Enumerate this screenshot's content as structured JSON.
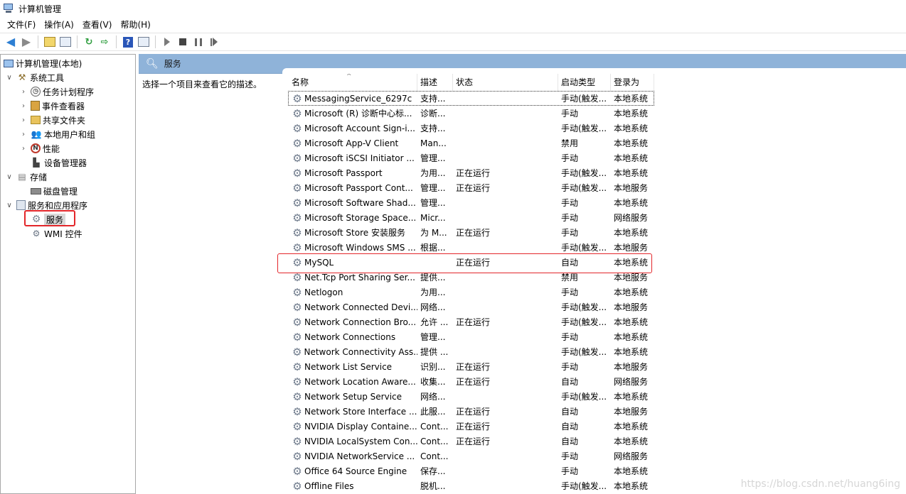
{
  "window": {
    "title": "计算机管理"
  },
  "menu": [
    "文件(F)",
    "操作(A)",
    "查看(V)",
    "帮助(H)"
  ],
  "tree": {
    "root": "计算机管理(本地)",
    "system_tools": "系统工具",
    "task_scheduler": "任务计划程序",
    "event_viewer": "事件查看器",
    "shared_folders": "共享文件夹",
    "local_users": "本地用户和组",
    "performance": "性能",
    "device_manager": "设备管理器",
    "storage": "存储",
    "disk_management": "磁盘管理",
    "services_apps": "服务和应用程序",
    "services": "服务",
    "wmi": "WMI 控件"
  },
  "panel": {
    "title": "服务",
    "description_hint": "选择一个项目来查看它的描述。"
  },
  "columns": {
    "name": "名称",
    "desc": "描述",
    "status": "状态",
    "startup": "启动类型",
    "logon": "登录为"
  },
  "services": [
    {
      "name": "MessagingService_6297c",
      "desc": "支持...",
      "status": "",
      "startup": "手动(触发...",
      "logon": "本地系统"
    },
    {
      "name": "Microsoft (R) 诊断中心标...",
      "desc": "诊断...",
      "status": "",
      "startup": "手动",
      "logon": "本地系统"
    },
    {
      "name": "Microsoft Account Sign-i...",
      "desc": "支持...",
      "status": "",
      "startup": "手动(触发...",
      "logon": "本地系统"
    },
    {
      "name": "Microsoft App-V Client",
      "desc": "Man...",
      "status": "",
      "startup": "禁用",
      "logon": "本地系统"
    },
    {
      "name": "Microsoft iSCSI Initiator ...",
      "desc": "管理...",
      "status": "",
      "startup": "手动",
      "logon": "本地系统"
    },
    {
      "name": "Microsoft Passport",
      "desc": "为用...",
      "status": "正在运行",
      "startup": "手动(触发...",
      "logon": "本地系统"
    },
    {
      "name": "Microsoft Passport Cont...",
      "desc": "管理...",
      "status": "正在运行",
      "startup": "手动(触发...",
      "logon": "本地服务"
    },
    {
      "name": "Microsoft Software Shad...",
      "desc": "管理...",
      "status": "",
      "startup": "手动",
      "logon": "本地系统"
    },
    {
      "name": "Microsoft Storage Space...",
      "desc": "Micr...",
      "status": "",
      "startup": "手动",
      "logon": "网络服务"
    },
    {
      "name": "Microsoft Store 安装服务",
      "desc": "为 M...",
      "status": "正在运行",
      "startup": "手动",
      "logon": "本地系统"
    },
    {
      "name": "Microsoft Windows SMS ...",
      "desc": "根据...",
      "status": "",
      "startup": "手动(触发...",
      "logon": "本地服务"
    },
    {
      "name": "MySQL",
      "desc": "",
      "status": "正在运行",
      "startup": "自动",
      "logon": "本地系统"
    },
    {
      "name": "Net.Tcp Port Sharing Ser...",
      "desc": "提供...",
      "status": "",
      "startup": "禁用",
      "logon": "本地服务"
    },
    {
      "name": "Netlogon",
      "desc": "为用...",
      "status": "",
      "startup": "手动",
      "logon": "本地系统"
    },
    {
      "name": "Network Connected Devi...",
      "desc": "网络...",
      "status": "",
      "startup": "手动(触发...",
      "logon": "本地服务"
    },
    {
      "name": "Network Connection Bro...",
      "desc": "允许 ...",
      "status": "正在运行",
      "startup": "手动(触发...",
      "logon": "本地系统"
    },
    {
      "name": "Network Connections",
      "desc": "管理...",
      "status": "",
      "startup": "手动",
      "logon": "本地系统"
    },
    {
      "name": "Network Connectivity Ass...",
      "desc": "提供 ...",
      "status": "",
      "startup": "手动(触发...",
      "logon": "本地系统"
    },
    {
      "name": "Network List Service",
      "desc": "识别...",
      "status": "正在运行",
      "startup": "手动",
      "logon": "本地服务"
    },
    {
      "name": "Network Location Aware...",
      "desc": "收集...",
      "status": "正在运行",
      "startup": "自动",
      "logon": "网络服务"
    },
    {
      "name": "Network Setup Service",
      "desc": "网络...",
      "status": "",
      "startup": "手动(触发...",
      "logon": "本地系统"
    },
    {
      "name": "Network Store Interface ...",
      "desc": "此服...",
      "status": "正在运行",
      "startup": "自动",
      "logon": "本地服务"
    },
    {
      "name": "NVIDIA Display Containe...",
      "desc": "Cont...",
      "status": "正在运行",
      "startup": "自动",
      "logon": "本地系统"
    },
    {
      "name": "NVIDIA LocalSystem Con...",
      "desc": "Cont...",
      "status": "正在运行",
      "startup": "自动",
      "logon": "本地系统"
    },
    {
      "name": "NVIDIA NetworkService ...",
      "desc": "Cont...",
      "status": "",
      "startup": "手动",
      "logon": "网络服务"
    },
    {
      "name": "Office 64 Source Engine",
      "desc": "保存...",
      "status": "",
      "startup": "手动",
      "logon": "本地系统"
    },
    {
      "name": "Offline Files",
      "desc": "脱机...",
      "status": "",
      "startup": "手动(触发...",
      "logon": "本地系统"
    }
  ],
  "watermark": "https://blog.csdn.net/huang6ing",
  "colors": {
    "panel_header": "#8fb3d9",
    "highlight": "#e3262a"
  }
}
